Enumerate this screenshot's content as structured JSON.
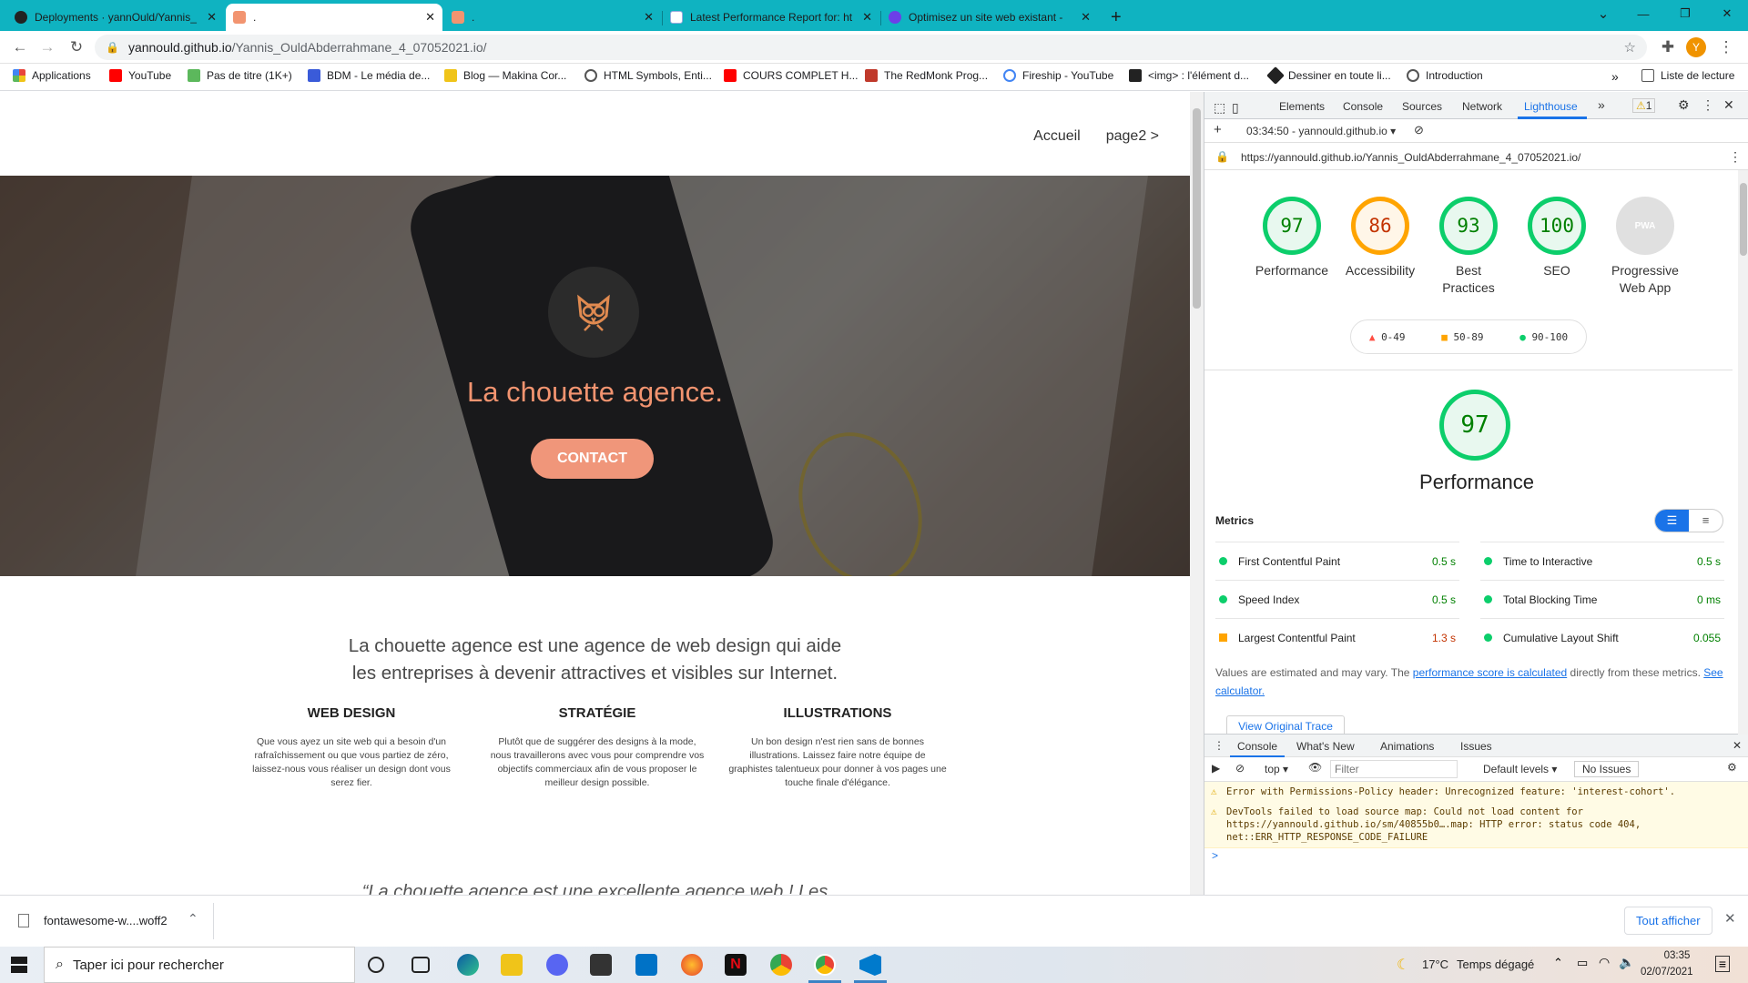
{
  "browser": {
    "tabs": [
      {
        "title": "Deployments · yannOuld/Yannis_",
        "active": false
      },
      {
        "title": ".",
        "active": true
      },
      {
        "title": ".",
        "active": false
      },
      {
        "title": "Latest Performance Report for: ht",
        "active": false
      },
      {
        "title": "Optimisez un site web existant -",
        "active": false
      }
    ],
    "new_tab": "+",
    "url_host": "yannould.github.io",
    "url_path": "/Yannis_OuldAbderrahmane_4_07052021.io/",
    "profile_initial": "Y",
    "bookmarks": [
      {
        "label": "Applications",
        "color": "#e8453c"
      },
      {
        "label": "YouTube",
        "color": "#ff0000"
      },
      {
        "label": "Pas de titre (1K+)",
        "color": "#5cb85c"
      },
      {
        "label": "BDM - Le média de...",
        "color": "#3a5bd9"
      },
      {
        "label": "Blog — Makina Cor...",
        "color": "#f0c419"
      },
      {
        "label": "HTML Symbols, Enti...",
        "color": "#555555"
      },
      {
        "label": "COURS COMPLET H...",
        "color": "#ff0000"
      },
      {
        "label": "The RedMonk Prog...",
        "color": "#c0392b"
      },
      {
        "label": "Fireship - YouTube",
        "color": "#4285f4"
      },
      {
        "label": "<img> : l'élément d...",
        "color": "#222222"
      },
      {
        "label": "Dessiner en toute li...",
        "color": "#222222"
      },
      {
        "label": "Introduction",
        "color": "#555555"
      }
    ],
    "reading_list": "Liste de lecture"
  },
  "site": {
    "nav": [
      "Accueil",
      "page2 >"
    ],
    "hero_title": "La chouette agence.",
    "contact": "CONTACT",
    "intro_line1": "La chouette agence est une agence de web design qui aide",
    "intro_line2": "les entreprises à devenir attractives et visibles sur Internet.",
    "services": [
      {
        "title": "WEB DESIGN",
        "text": "Que vous ayez un site web qui a besoin d'un rafraîchissement ou que vous partiez de zéro, laissez-nous vous réaliser un design dont vous serez fier."
      },
      {
        "title": "STRATÉGIE",
        "text": "Plutôt que de suggérer des designs à la mode, nous travaillerons avec vous pour comprendre vos objectifs commerciaux afin de vous proposer le meilleur design possible."
      },
      {
        "title": "ILLUSTRATIONS",
        "text": "Un bon design n'est rien sans de bonnes illustrations. Laissez faire notre équipe de graphistes talentueux pour donner à vos pages une touche finale d'élégance."
      }
    ],
    "quote": "“La chouette agence est une excellente agence web ! Les"
  },
  "devtools": {
    "tabs": [
      "Elements",
      "Console",
      "Sources",
      "Network",
      "Lighthouse"
    ],
    "active_tab": "Lighthouse",
    "more": "»",
    "warning_count": "1",
    "report_selector": "03:34:50 - yannould.github.io",
    "report_url": "https://yannould.github.io/Yannis_OuldAbderrahmane_4_07052021.io/",
    "scores": [
      {
        "label": "Performance",
        "value": "97",
        "color": "#0cce6b"
      },
      {
        "label": "Accessibility",
        "value": "86",
        "color": "#ffa400"
      },
      {
        "label": "Best Practices",
        "value": "93",
        "color": "#0cce6b"
      },
      {
        "label": "SEO",
        "value": "100",
        "color": "#0cce6b"
      },
      {
        "label": "Progressive Web App",
        "value": "PWA",
        "color": "#cccccc"
      }
    ],
    "legend": [
      "0-49",
      "50-89",
      "90-100"
    ],
    "main_score": "97",
    "main_title": "Performance",
    "metrics_title": "Metrics",
    "metrics": [
      {
        "name": "First Contentful Paint",
        "value": "0.5 s",
        "status": "pass"
      },
      {
        "name": "Time to Interactive",
        "value": "0.5 s",
        "status": "pass"
      },
      {
        "name": "Speed Index",
        "value": "0.5 s",
        "status": "pass"
      },
      {
        "name": "Total Blocking Time",
        "value": "0 ms",
        "status": "pass"
      },
      {
        "name": "Largest Contentful Paint",
        "value": "1.3 s",
        "status": "average"
      },
      {
        "name": "Cumulative Layout Shift",
        "value": "0.055",
        "status": "pass"
      }
    ],
    "note_pre": "Values are estimated and may vary. The ",
    "note_link1": "performance score is calculated",
    "note_mid": " directly from these metrics. ",
    "note_link2": "See calculator.",
    "view_trace": "View Original Trace",
    "drawer_tabs": [
      "Console",
      "What's New",
      "Animations",
      "Issues"
    ],
    "context": "top",
    "filter_placeholder": "Filter",
    "levels": "Default levels",
    "issues": "No Issues",
    "messages": [
      "Error with Permissions-Policy header: Unrecognized feature: 'interest-cohort'.",
      "DevTools failed to load source map: Could not load content for https://yannould.github.io/sm/40855b0….map: HTTP error: status code 404, net::ERR_HTTP_RESPONSE_CODE_FAILURE"
    ],
    "prompt": ">"
  },
  "downloads": {
    "file": "fontawesome-w....woff2",
    "show_all": "Tout afficher"
  },
  "taskbar": {
    "search_placeholder": "Taper ici pour rechercher",
    "weather_temp": "17°C",
    "weather_text": "Temps dégagé",
    "time": "03:35",
    "date": "02/07/2021"
  }
}
